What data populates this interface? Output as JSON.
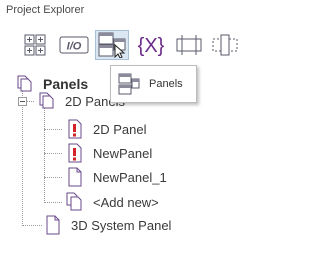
{
  "panel": {
    "title": "Project Explorer"
  },
  "toolbar": {
    "buttons": [
      {
        "name": "grid-icon"
      },
      {
        "name": "io-icon",
        "label": "I/O"
      },
      {
        "name": "panels-icon",
        "active": true
      },
      {
        "name": "braces-x-icon",
        "label": "{X}"
      },
      {
        "name": "bar-icon"
      },
      {
        "name": "dashed-bar-icon"
      }
    ]
  },
  "tooltip": {
    "label": "Panels"
  },
  "tree": {
    "root": {
      "label": "Panels"
    },
    "group": {
      "label": "2D Panels"
    },
    "items": [
      {
        "label": "2D Panel",
        "icon": "panel-error-icon"
      },
      {
        "label": "NewPanel",
        "icon": "panel-error-icon"
      },
      {
        "label": "NewPanel_1",
        "icon": "panel-icon"
      },
      {
        "label": "<Add new>",
        "icon": "add-new-panel-icon"
      }
    ],
    "system": {
      "label": "3D System Panel"
    }
  },
  "colors": {
    "error": "#d4232a",
    "icon_border": "#5a5a6a",
    "active_bg": "#dbe6f3",
    "purple": "#6b2a8a"
  }
}
